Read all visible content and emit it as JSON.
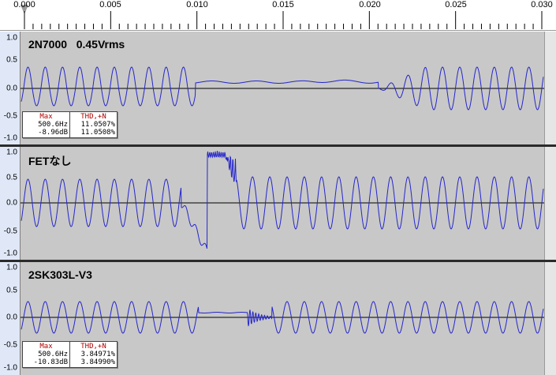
{
  "ruler": {
    "ticks": [
      "0.000",
      "0.005",
      "0.010",
      "0.015",
      "0.020",
      "0.025",
      "0.030"
    ]
  },
  "colors": {
    "waveform": "#2525cc",
    "background": "#c8c8c8",
    "vruler": "#e0e8f8",
    "measure_header": "#b00000"
  },
  "tracks": [
    {
      "title": "2N7000   0.45Vrms",
      "scale": [
        "1.0",
        "0.5",
        "0.0",
        "-0.5",
        "-1.0"
      ],
      "has_measure": true,
      "measure": {
        "max_header": "Max",
        "max_freq": "500.6Hz",
        "max_db": "-8.96dB",
        "thd_header": "THD,+N",
        "thd_1": "11.0507%",
        "thd_2": "11.0508%"
      }
    },
    {
      "title": "FETなし",
      "scale": [
        "1.0",
        "0.5",
        "0.0",
        "-0.5",
        "-1.0"
      ],
      "has_measure": false
    },
    {
      "title": "2SK303L-V3",
      "scale": [
        "1.0",
        "0.5",
        "0.0",
        "-0.5",
        "-1.0"
      ],
      "has_measure": true,
      "measure": {
        "max_header": "Max",
        "max_freq": "500.6Hz",
        "max_db": "-10.83dB",
        "thd_header": "THD,+N",
        "thd_1": "3.84971%",
        "thd_2": "3.84990%"
      }
    }
  ]
}
